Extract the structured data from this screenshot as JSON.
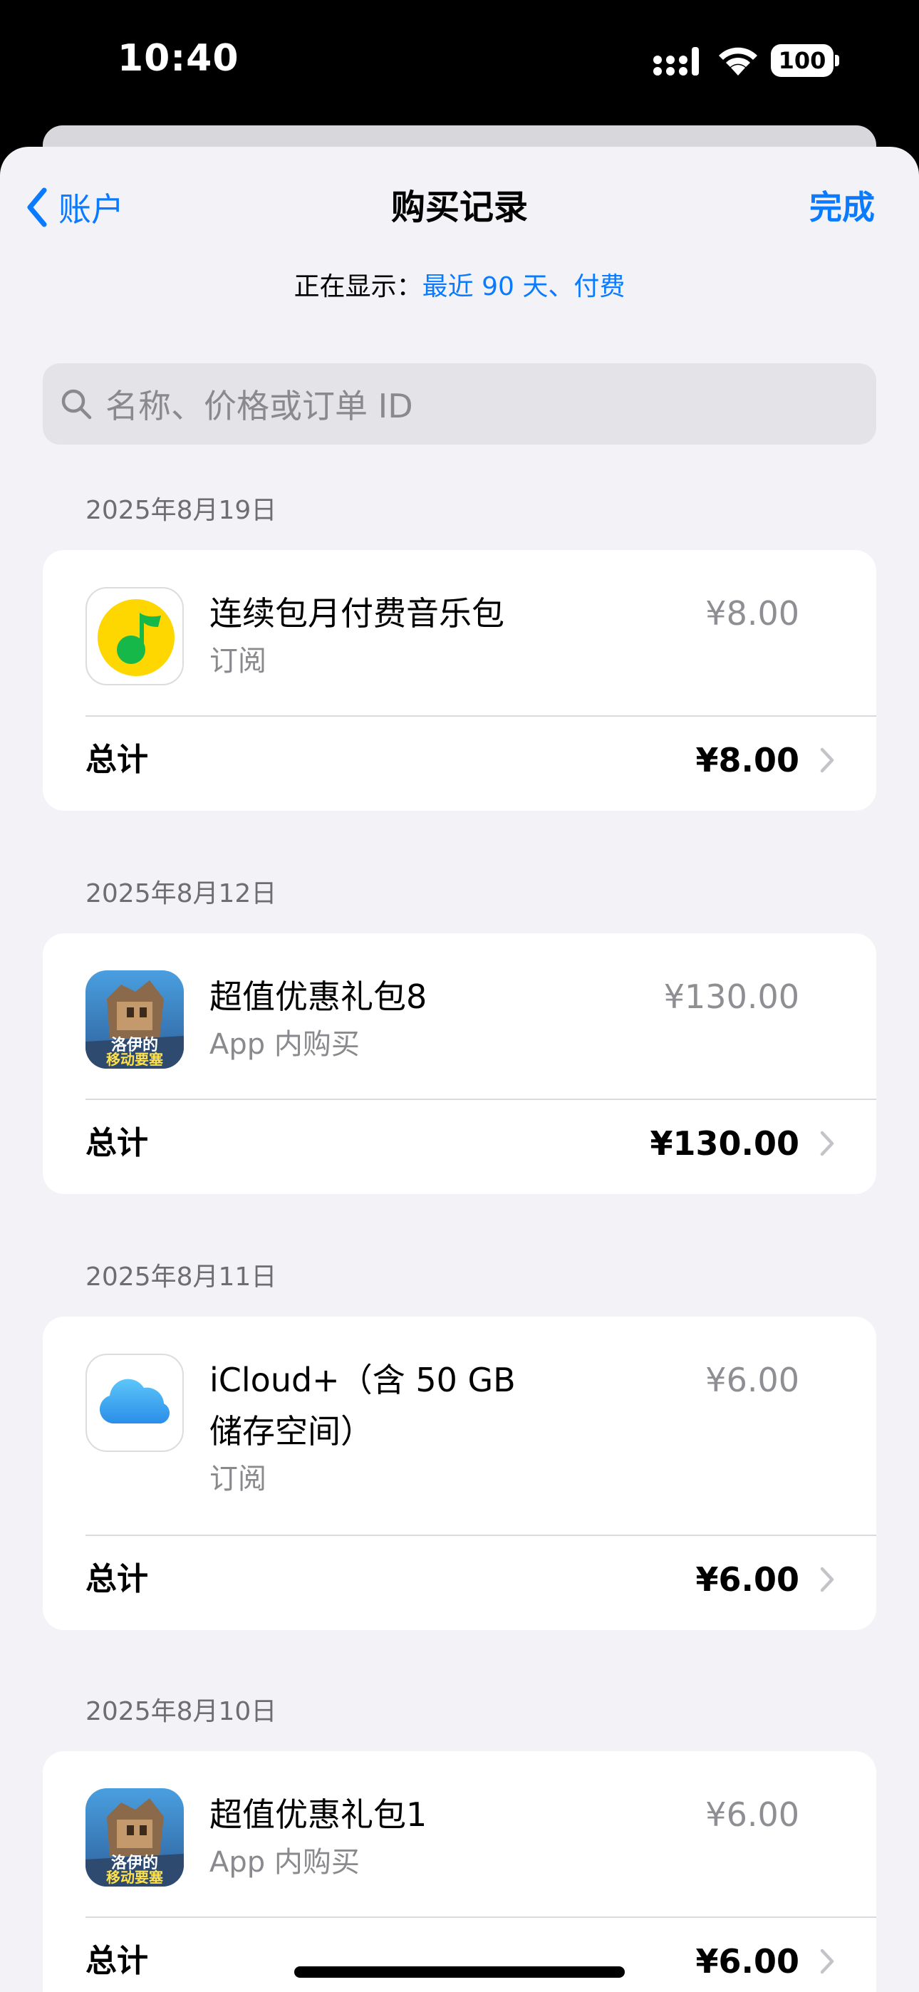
{
  "status_bar": {
    "time": "10:40",
    "battery": "100"
  },
  "nav": {
    "back_label": "账户",
    "title": "购买记录",
    "done_label": "完成"
  },
  "filter": {
    "prefix": "正在显示：",
    "value": "最近 90 天、付费"
  },
  "search": {
    "placeholder": "名称、价格或订单 ID"
  },
  "purchases": [
    {
      "date": "2025年8月19日",
      "name": "连续包月付费音乐包",
      "type": "订阅",
      "price": "¥8.00",
      "total_label": "总计",
      "total": "¥8.00",
      "icon": "qq-music-icon"
    },
    {
      "date": "2025年8月12日",
      "name": "超值优惠礼包8",
      "type": "App 内购买",
      "price": "¥130.00",
      "total_label": "总计",
      "total": "¥130.00",
      "icon": "game-icon"
    },
    {
      "date": "2025年8月11日",
      "name_line1": "iCloud+（含 50 GB",
      "name_line2": "储存空间）",
      "type": "订阅",
      "price": "¥6.00",
      "total_label": "总计",
      "total": "¥6.00",
      "icon": "icloud-icon"
    },
    {
      "date": "2025年8月10日",
      "name": "超值优惠礼包1",
      "type": "App 内购买",
      "price": "¥6.00",
      "total_label": "总计",
      "total": "¥6.00",
      "icon": "game-icon"
    }
  ],
  "colors": {
    "accent": "#0a7bff",
    "background": "#f2f2f7",
    "secondary_text": "#8e8e93"
  }
}
